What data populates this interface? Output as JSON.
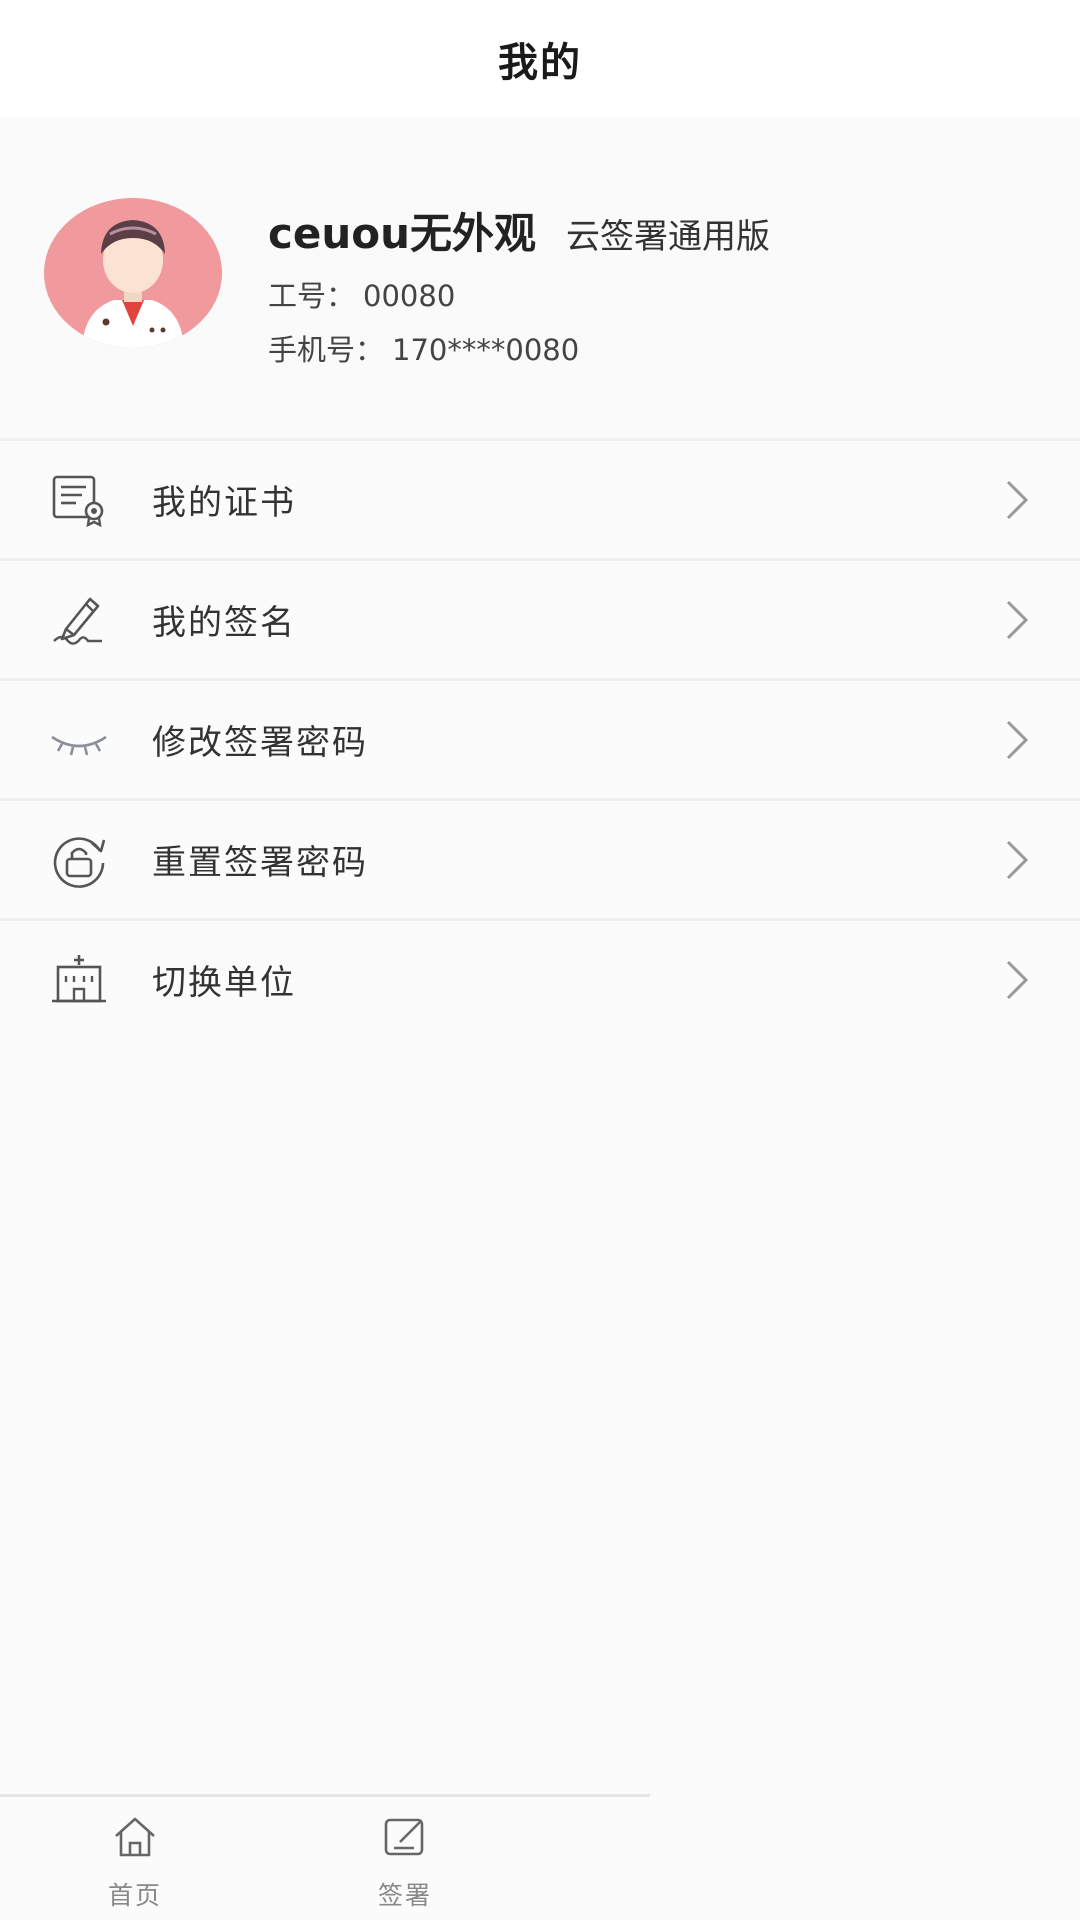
{
  "header": {
    "title": "我的"
  },
  "profile": {
    "name": "ceuou无外观",
    "edition": "云签署通用版",
    "employee_id_label": "工号：",
    "employee_id": "00080",
    "phone_label": "手机号：",
    "phone": "170****0080",
    "avatar_icon": "doctor-avatar-icon"
  },
  "menu": {
    "items": [
      {
        "label": "我的证书",
        "icon": "certificate-icon"
      },
      {
        "label": "我的签名",
        "icon": "signature-pen-icon"
      },
      {
        "label": "修改签署密码",
        "icon": "closed-eye-icon"
      },
      {
        "label": "重置签署密码",
        "icon": "reset-lock-icon"
      },
      {
        "label": "切换单位",
        "icon": "hospital-building-icon"
      }
    ]
  },
  "bottom_nav": {
    "items": [
      {
        "label": "首页",
        "icon": "home-icon"
      },
      {
        "label": "签署",
        "icon": "sign-edit-icon"
      }
    ]
  },
  "colors": {
    "avatar_bg": "#f09a9d",
    "background": "#fbfbfc",
    "icon_gray": "#666666"
  }
}
